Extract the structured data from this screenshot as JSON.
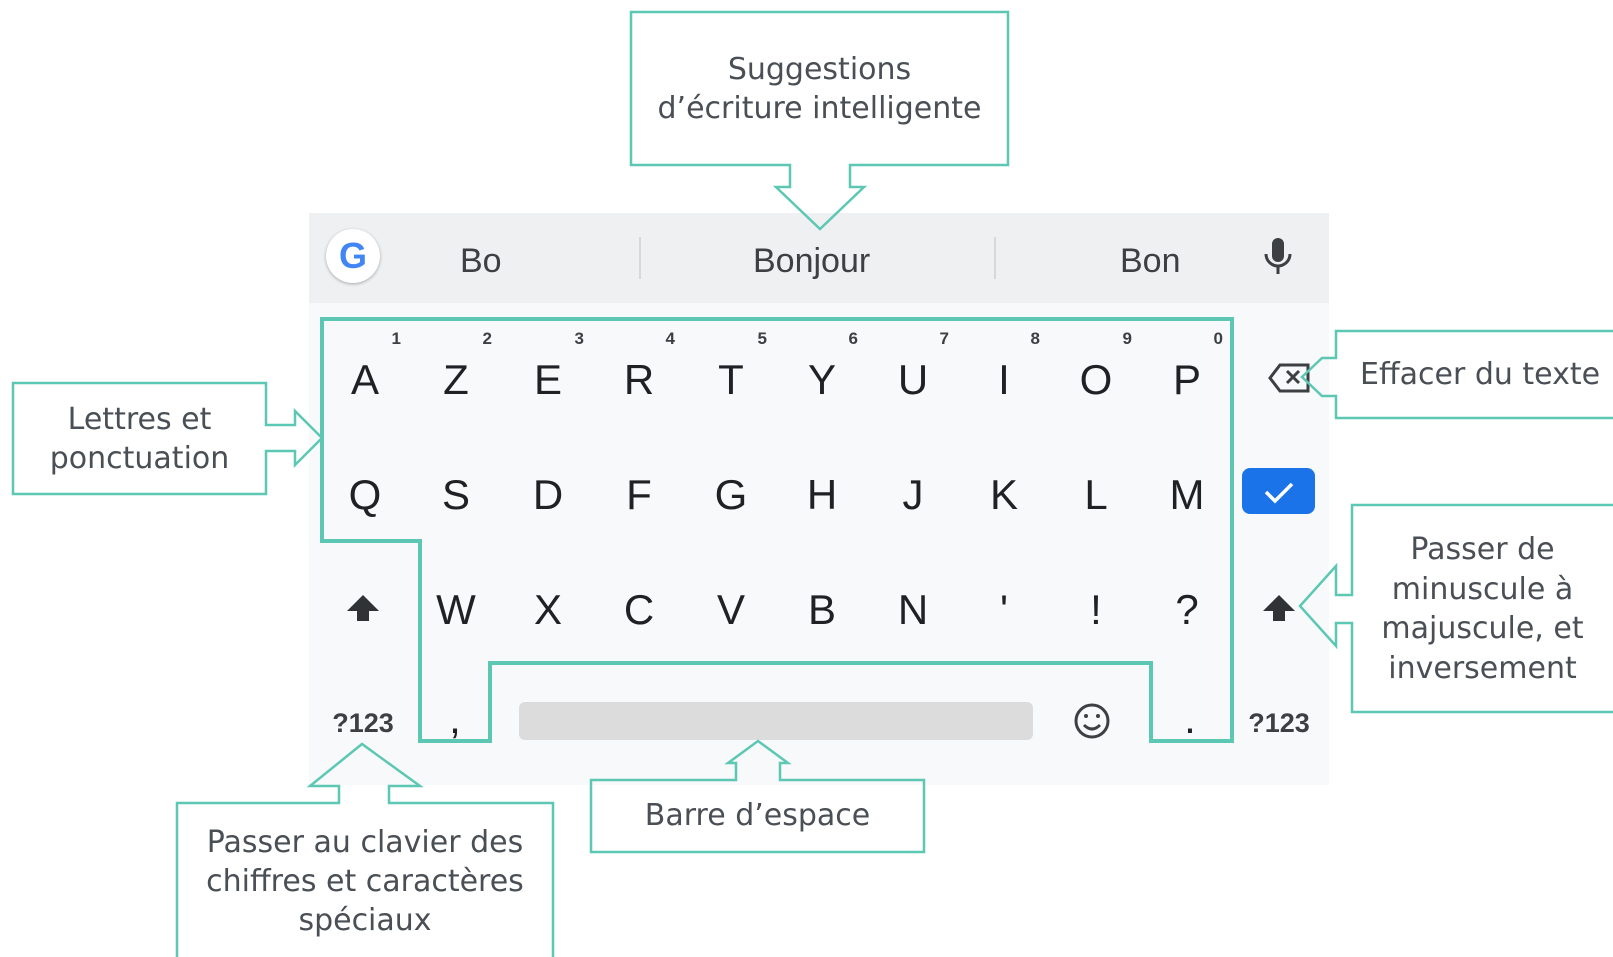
{
  "keyboard": {
    "suggestions": [
      "Bo",
      "Bonjour",
      "Bon"
    ],
    "google_letter": "G",
    "row1": [
      {
        "label": "A",
        "hint": "1"
      },
      {
        "label": "Z",
        "hint": "2"
      },
      {
        "label": "E",
        "hint": "3"
      },
      {
        "label": "R",
        "hint": "4"
      },
      {
        "label": "T",
        "hint": "5"
      },
      {
        "label": "Y",
        "hint": "6"
      },
      {
        "label": "U",
        "hint": "7"
      },
      {
        "label": "I",
        "hint": "8"
      },
      {
        "label": "O",
        "hint": "9"
      },
      {
        "label": "P",
        "hint": "0"
      }
    ],
    "row2": [
      "Q",
      "S",
      "D",
      "F",
      "G",
      "H",
      "J",
      "K",
      "L",
      "M"
    ],
    "row3": [
      "W",
      "X",
      "C",
      "V",
      "B",
      "N",
      "'",
      "!",
      "?"
    ],
    "comma": ",",
    "period": ".",
    "symbols_left": "?123",
    "symbols_right": "?123",
    "icons": {
      "mic": "microphone-icon",
      "backspace": "backspace-icon",
      "enter": "checkmark-icon",
      "shift": "shift-arrow-icon",
      "emoji": "smiley-icon"
    },
    "colors": {
      "enter_key": "#1a73e8",
      "suggestion_bar": "#eef0f2",
      "keyboard_bg": "#f8f9fa"
    }
  },
  "callouts": {
    "suggestions": [
      "Suggestions",
      "d’écriture intelligente"
    ],
    "letters": [
      "Lettres et",
      "ponctuation"
    ],
    "delete": [
      "Effacer du texte"
    ],
    "case": [
      "Passer de",
      "minuscule à",
      "majuscule, et",
      "inversement"
    ],
    "space": [
      "Barre d’espace"
    ],
    "numbers": [
      "Passer au clavier des",
      "chiffres et caractères",
      "spéciaux"
    ]
  },
  "accent_color": "#5cc8b4"
}
